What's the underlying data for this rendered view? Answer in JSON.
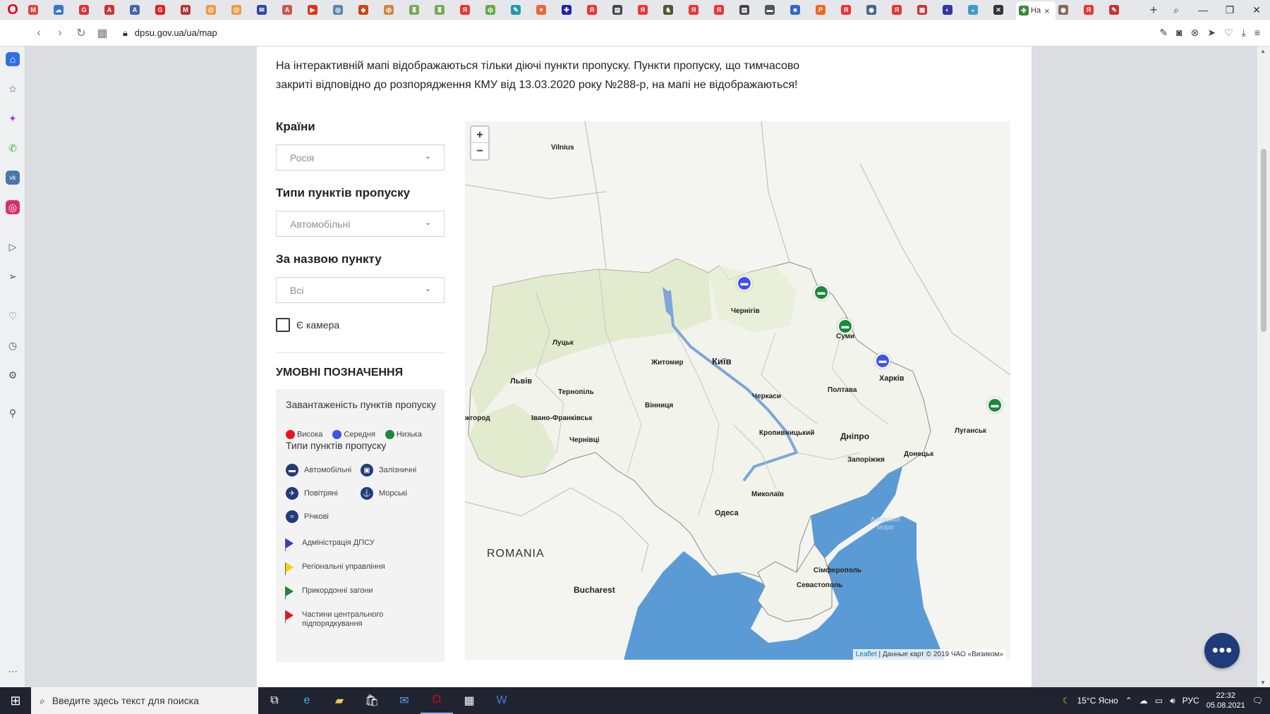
{
  "browser": {
    "tab_favicons": [
      {
        "letter": "M",
        "color": "#d44"
      },
      {
        "letter": "☁",
        "color": "#37c"
      },
      {
        "letter": "G",
        "color": "#d33"
      },
      {
        "letter": "A",
        "color": "#c33"
      },
      {
        "letter": "A",
        "color": "#46a"
      },
      {
        "letter": "G",
        "color": "#d22"
      },
      {
        "letter": "M",
        "color": "#b33"
      },
      {
        "letter": "@",
        "color": "#e94"
      },
      {
        "letter": "@",
        "color": "#e94"
      },
      {
        "letter": "✉",
        "color": "#34a"
      },
      {
        "letter": "A",
        "color": "#c55"
      },
      {
        "letter": "▶",
        "color": "#d31"
      },
      {
        "letter": "◎",
        "color": "#58a"
      },
      {
        "letter": "◆",
        "color": "#c41"
      },
      {
        "letter": "ф",
        "color": "#c84"
      },
      {
        "letter": "♜",
        "color": "#7a5"
      },
      {
        "letter": "♜",
        "color": "#7a5"
      },
      {
        "letter": "Я",
        "color": "#e33"
      },
      {
        "letter": "ф",
        "color": "#6a4"
      },
      {
        "letter": "✎",
        "color": "#29a"
      },
      {
        "letter": "♥",
        "color": "#e63"
      },
      {
        "letter": "✚",
        "color": "#22a"
      },
      {
        "letter": "Я",
        "color": "#e33"
      },
      {
        "letter": "▤",
        "color": "#444"
      },
      {
        "letter": "Я",
        "color": "#e33"
      },
      {
        "letter": "♞",
        "color": "#553"
      },
      {
        "letter": "Я",
        "color": "#e33"
      },
      {
        "letter": "Я",
        "color": "#e33"
      },
      {
        "letter": "▤",
        "color": "#444"
      },
      {
        "letter": "▬",
        "color": "#555"
      },
      {
        "letter": "■",
        "color": "#36c"
      },
      {
        "letter": "P",
        "color": "#e62"
      },
      {
        "letter": "Я",
        "color": "#e33"
      },
      {
        "letter": "◉",
        "color": "#468"
      },
      {
        "letter": "Я",
        "color": "#e33"
      },
      {
        "letter": "▣",
        "color": "#c33"
      },
      {
        "letter": "◐",
        "color": "#33a"
      },
      {
        "letter": "◒",
        "color": "#49c"
      },
      {
        "letter": "✕",
        "color": "#333"
      }
    ],
    "active_tab": {
      "title": "На",
      "favicon": "✚",
      "favicon_color": "#3a8a3a"
    },
    "tabs_after": [
      {
        "letter": "◉",
        "color": "#865"
      },
      {
        "letter": "Я",
        "color": "#e33"
      },
      {
        "letter": "✎",
        "color": "#c33"
      }
    ],
    "url": "dpsu.gov.ua/ua/map"
  },
  "page": {
    "notice": "На інтерактивній мапі відображаються тільки діючі пункти пропуску. Пункти пропуску, що тимчасово закриті відповідно до розпорядження КМУ від 13.03.2020 року №288-р, на мапі не відображаються!",
    "filters": {
      "countries_label": "Країни",
      "countries_value": "Росія",
      "types_label": "Типи пунктів пропуску",
      "types_value": "Автомобільні",
      "name_label": "За назвою пункту",
      "name_value": "Всі",
      "camera_label": "Є камера"
    },
    "legend": {
      "title": "УМОВНІ ПОЗНАЧЕННЯ",
      "load_heading": "Завантаженість пунктів пропуску",
      "load_levels": [
        {
          "label": "Висока",
          "color": "#e8141c"
        },
        {
          "label": "Середня",
          "color": "#3c55e6"
        },
        {
          "label": "Низька",
          "color": "#1a8a3a"
        }
      ],
      "types_heading": "Типи пунктів пропуску",
      "types": [
        "Автомобільні",
        "Залізничні",
        "Повітряні",
        "Морські",
        "Річкові"
      ],
      "flags": [
        {
          "label": "Адміністрація ДПСУ",
          "color": "#2b3fc9"
        },
        {
          "label": "Регіональні управління",
          "color": "#f2d400"
        },
        {
          "label": "Прикордонні загони",
          "color": "#1f8a2f"
        },
        {
          "label": "Частини центрального підпорядкування",
          "color": "#e8141c"
        }
      ]
    },
    "map": {
      "zoom_in": "+",
      "zoom_out": "−",
      "cities": {
        "vilnius": "Vilnius",
        "chernihiv": "Чернігів",
        "sumy": "Суми",
        "lutsk": "Луцьк",
        "zhytomyr": "Житомир",
        "kyiv": "Київ",
        "kharkiv": "Харків",
        "lviv": "Львів",
        "ternopil": "Тернопіль",
        "vinnytsia": "Вінниця",
        "cherkasy": "Черкаси",
        "poltava": "Полтава",
        "uzhhorod": "жгород",
        "ivano": "Івано-Франківськ",
        "chernivtsi": "Чернівці",
        "kropyvnytskyi": "Кропивницький",
        "dnipro": "Дніпро",
        "luhansk": "Луганськ",
        "donetsk": "Донецьк",
        "zaporizhzhia": "Запоріжжя",
        "mykolaiv": "Миколаїв",
        "odesa": "Одеса",
        "azov": "Азовське море",
        "simferopol": "Сімферополь",
        "sevastopol": "Севастополь",
        "bucharest": "Bucharest"
      },
      "country_label": "ROMANIA",
      "attribution_link": "Leaflet",
      "attribution_text": "| Данные карт © 2019 ЧАО «Визиком»"
    }
  },
  "taskbar": {
    "search_placeholder": "Введите здесь текст для поиска",
    "weather": "15°C  Ясно",
    "language": "РУС",
    "time": "22:32",
    "date": "05.08.2021"
  }
}
